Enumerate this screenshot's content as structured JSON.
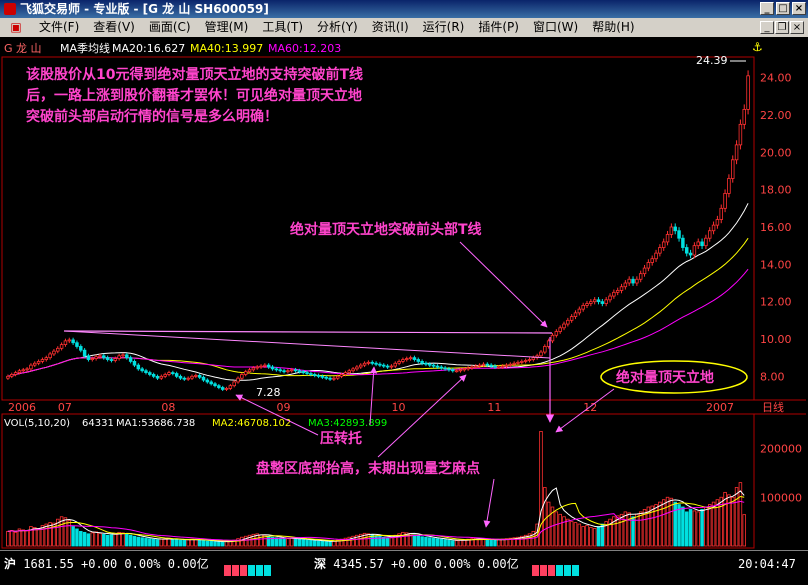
{
  "window": {
    "title": "飞狐交易师 - 专业版 - [G 龙  山 SH600059]"
  },
  "menu": [
    "文件(F)",
    "查看(V)",
    "画面(C)",
    "管理(M)",
    "工具(T)",
    "分析(Y)",
    "资讯(I)",
    "运行(R)",
    "插件(P)",
    "窗口(W)",
    "帮助(H)"
  ],
  "header": {
    "stock": "G 龙  山",
    "indicator": "MA季均线",
    "ma20": "MA20:16.627",
    "ma40": "MA40:13.997",
    "ma60": "MA60:12.203",
    "ma20_color": "#ffffff",
    "ma40_color": "#ffff00",
    "ma60_color": "#ff00ff"
  },
  "price_axis": {
    "ticks": [
      "24.00",
      "22.00",
      "20.00",
      "18.00",
      "16.00",
      "14.00",
      "12.00",
      "10.00",
      "8.00"
    ],
    "high_label": "24.39",
    "low_label": "7.28"
  },
  "time_axis": {
    "labels": [
      "2006",
      "07",
      "08",
      "09",
      "10",
      "11",
      "12",
      "2007"
    ],
    "unit": "日线"
  },
  "volume_header": {
    "title": "VOL(5,10,20)",
    "value": "64331",
    "ma1": "MA1:53686.738",
    "ma2": "MA2:46708.102",
    "ma3": "MA3:42893.899"
  },
  "volume_axis": {
    "ticks": [
      "200000",
      "100000"
    ]
  },
  "annotations": {
    "text_line1": "该股股价从10元得到绝对量顶天立地的支持突破前T线",
    "text_line2": "后，一路上涨到股价翻番才罢休！可见绝对量顶天立地",
    "text_line3": "突破前头部启动行情的信号是多么明确！",
    "breakout": "绝对量顶天立地突破前头部T线",
    "support": "压转托",
    "bottom": "盘整区底部抬高，末期出现量芝麻点",
    "ellipse": "绝对量顶天立地"
  },
  "status": {
    "sh_label": "沪",
    "sh_value": "1681.55 +0.00 0.00% 0.00亿",
    "sz_label": "深",
    "sz_value": "4345.57 +0.00 0.00% 0.00亿",
    "time": "20:04:47"
  },
  "chart_data": {
    "type": "candlestick",
    "price_ylim": [
      7.0,
      25.0
    ],
    "volume_ylim": [
      0,
      240000
    ],
    "period_labels": [
      "2006",
      "07",
      "08",
      "09",
      "10",
      "11",
      "12",
      "2007"
    ],
    "period_start_index": [
      0,
      13,
      40,
      70,
      100,
      125,
      150,
      182
    ],
    "close": [
      8.0,
      8.1,
      8.2,
      8.3,
      8.35,
      8.4,
      8.6,
      8.7,
      8.8,
      8.9,
      9.0,
      9.2,
      9.35,
      9.5,
      9.7,
      9.9,
      9.95,
      9.8,
      9.6,
      9.4,
      9.1,
      8.9,
      8.95,
      9.05,
      9.1,
      9.0,
      8.9,
      8.85,
      8.95,
      9.1,
      9.15,
      9.0,
      8.8,
      8.6,
      8.4,
      8.3,
      8.2,
      8.1,
      8.0,
      7.9,
      8.0,
      8.1,
      8.2,
      8.15,
      8.0,
      7.9,
      7.85,
      7.9,
      8.0,
      8.05,
      7.95,
      7.8,
      7.7,
      7.6,
      7.5,
      7.4,
      7.3,
      7.35,
      7.5,
      7.7,
      7.9,
      8.1,
      8.25,
      8.35,
      8.45,
      8.5,
      8.55,
      8.6,
      8.5,
      8.4,
      8.35,
      8.3,
      8.25,
      8.3,
      8.35,
      8.3,
      8.25,
      8.2,
      8.15,
      8.1,
      8.05,
      8.0,
      7.95,
      7.9,
      7.85,
      7.9,
      8.0,
      8.1,
      8.2,
      8.3,
      8.4,
      8.5,
      8.6,
      8.7,
      8.75,
      8.7,
      8.65,
      8.6,
      8.55,
      8.5,
      8.55,
      8.7,
      8.8,
      8.9,
      8.95,
      9.0,
      8.9,
      8.8,
      8.7,
      8.65,
      8.6,
      8.55,
      8.5,
      8.45,
      8.4,
      8.35,
      8.3,
      8.3,
      8.35,
      8.4,
      8.45,
      8.5,
      8.55,
      8.6,
      8.65,
      8.6,
      8.55,
      8.5,
      8.5,
      8.55,
      8.6,
      8.65,
      8.7,
      8.75,
      8.8,
      8.85,
      8.9,
      9.0,
      9.1,
      9.3,
      9.6,
      9.9,
      10.2,
      10.4,
      10.6,
      10.8,
      11.0,
      11.2,
      11.4,
      11.6,
      11.8,
      11.9,
      12.0,
      12.1,
      12.0,
      11.9,
      12.1,
      12.3,
      12.5,
      12.6,
      12.8,
      13.0,
      13.2,
      13.0,
      13.2,
      13.5,
      13.8,
      14.1,
      14.3,
      14.6,
      14.9,
      15.2,
      15.6,
      16.0,
      15.8,
      15.4,
      14.9,
      14.6,
      14.5,
      15.0,
      15.2,
      15.0,
      15.4,
      15.8,
      16.1,
      16.4,
      17.0,
      17.8,
      18.6,
      19.6,
      20.4,
      21.5,
      22.3,
      24.1
    ],
    "volume": [
      30000,
      32000,
      28000,
      35000,
      33000,
      31000,
      40000,
      38000,
      36000,
      42000,
      45000,
      48000,
      47000,
      55000,
      60000,
      58000,
      52000,
      40000,
      35000,
      30000,
      28000,
      25000,
      27000,
      29000,
      26000,
      24000,
      22000,
      23000,
      26000,
      28000,
      27000,
      25000,
      22000,
      20000,
      18000,
      17000,
      16000,
      15000,
      14000,
      13000,
      14000,
      15000,
      16000,
      14000,
      13000,
      12000,
      12000,
      13000,
      14000,
      13000,
      12000,
      11000,
      10000,
      10000,
      9000,
      9000,
      8000,
      9000,
      10000,
      12000,
      15000,
      18000,
      20000,
      22000,
      24000,
      25000,
      23000,
      22000,
      20000,
      18000,
      17000,
      16000,
      15000,
      15000,
      16000,
      15000,
      14000,
      13000,
      12000,
      12000,
      11000,
      10000,
      10000,
      9000,
      9000,
      10000,
      12000,
      14000,
      16000,
      18000,
      20000,
      22000,
      24000,
      26000,
      25000,
      23000,
      21000,
      20000,
      18000,
      17000,
      18000,
      22000,
      25000,
      28000,
      27000,
      26000,
      23000,
      21000,
      19000,
      18000,
      17000,
      16000,
      15000,
      14000,
      13000,
      12000,
      11000,
      11000,
      12000,
      13000,
      14000,
      15000,
      16000,
      15000,
      14000,
      13000,
      12000,
      12000,
      13000,
      14000,
      15000,
      16000,
      17000,
      18000,
      20000,
      22000,
      25000,
      30000,
      45000,
      235000,
      120000,
      90000,
      80000,
      70000,
      65000,
      60000,
      55000,
      50000,
      48000,
      45000,
      40000,
      42000,
      38000,
      36000,
      40000,
      45000,
      50000,
      55000,
      60000,
      62000,
      65000,
      70000,
      68000,
      60000,
      65000,
      70000,
      75000,
      80000,
      82000,
      85000,
      90000,
      95000,
      100000,
      98000,
      90000,
      85000,
      80000,
      70000,
      75000,
      72000,
      70000,
      75000,
      80000,
      85000,
      90000,
      95000,
      100000,
      110000,
      105000,
      100000,
      120000,
      130000,
      64331
    ]
  }
}
